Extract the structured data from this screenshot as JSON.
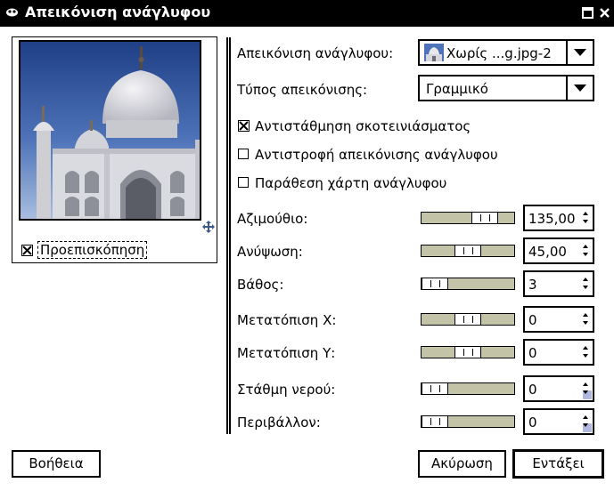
{
  "window": {
    "title": "Απεικόνιση ανάγλυφου"
  },
  "preview": {
    "checkbox_label": "Προεπισκόπηση",
    "checked": true
  },
  "options": {
    "emboss_map": {
      "label": "Απεικόνιση ανάγλυφου:",
      "value": "Χωρίς ...g.jpg-2"
    },
    "map_type": {
      "label": "Τύπος απεικόνισης:",
      "value": "Γραμμικό"
    },
    "checkboxes": [
      {
        "label": "Αντιστάθμηση σκοτεινιάσματος",
        "checked": true
      },
      {
        "label": "Αντιστροφή απεικόνισης ανάγλυφου",
        "checked": false
      },
      {
        "label": "Παράθεση χάρτη ανάγλυφου",
        "checked": false
      }
    ]
  },
  "params": [
    {
      "label": "Αζιμούθιο:",
      "value": "135,00",
      "level": 0.75,
      "min_reached": false
    },
    {
      "label": "Ανύψωση:",
      "value": "45,00",
      "level": 0.5,
      "min_reached": false
    },
    {
      "label": "Βάθος:",
      "value": "3",
      "level": 0.0,
      "min_reached": false
    },
    {
      "label": "Μετατόπιση Χ:",
      "value": "0",
      "level": 0.5,
      "min_reached": false
    },
    {
      "label": "Μετατόπιση Υ:",
      "value": "0",
      "level": 0.5,
      "min_reached": false
    },
    {
      "label": "Στάθμη νερού:",
      "value": "0",
      "level": 0.0,
      "min_reached": true
    },
    {
      "label": "Περιβάλλον:",
      "value": "0",
      "level": 0.0,
      "min_reached": true
    }
  ],
  "buttons": {
    "help": "Βοήθεια",
    "cancel": "Ακύρωση",
    "ok": "Εντάξει"
  },
  "colors": {
    "titlebar": "#000000",
    "scale_trough": "#c3c3a8",
    "spin_min_indicator": "#b0b8e0"
  }
}
